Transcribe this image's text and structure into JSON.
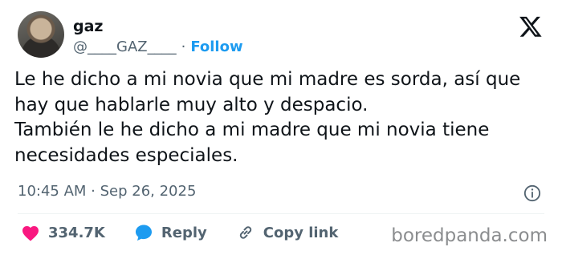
{
  "author": {
    "name": "gaz",
    "handle": "@____GAZ____",
    "separator": "·",
    "follow_label": "Follow"
  },
  "tweet": {
    "lines": [
      "Le he dicho a mi novia que mi madre es sorda, así que",
      "hay que hablarle muy alto y despacio.",
      "También le he dicho a mi madre que mi novia tiene",
      "necesidades especiales."
    ],
    "timestamp": "10:45 AM · Sep 26, 2025"
  },
  "actions": {
    "likes": "334.7K",
    "reply_label": "Reply",
    "copy_link_label": "Copy link"
  },
  "watermark": "boredpanda.com",
  "colors": {
    "link_blue": "#1d9bf0",
    "like_pink": "#f91880",
    "muted_gray": "#536471"
  },
  "icons": [
    "x-logo-icon",
    "info-icon",
    "heart-icon",
    "reply-bubble-icon",
    "link-icon"
  ]
}
